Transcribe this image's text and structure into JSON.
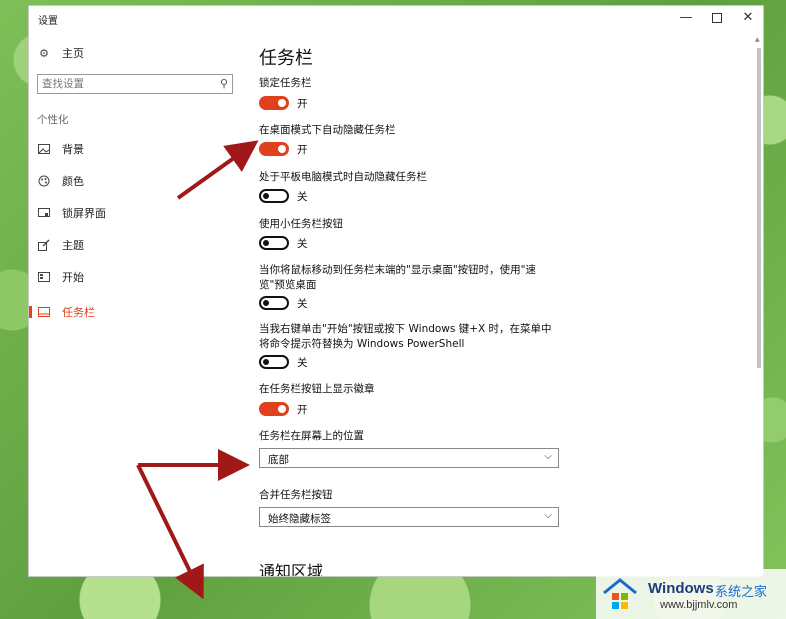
{
  "window": {
    "title": "设置",
    "min": "—",
    "close": "✕"
  },
  "sidebar": {
    "home": "主页",
    "search_placeholder": "查找设置",
    "group": "个性化",
    "items": [
      {
        "label": "背景",
        "icon": "image-icon"
      },
      {
        "label": "颜色",
        "icon": "palette-icon"
      },
      {
        "label": "锁屏界面",
        "icon": "lock-screen-icon"
      },
      {
        "label": "主题",
        "icon": "theme-icon"
      },
      {
        "label": "开始",
        "icon": "start-icon"
      },
      {
        "label": "任务栏",
        "icon": "taskbar-icon",
        "active": true
      }
    ],
    "accent": "#e0401b"
  },
  "content": {
    "title": "任务栏",
    "settings": [
      {
        "label": "锁定任务栏",
        "on": true,
        "state": "开"
      },
      {
        "label": "在桌面模式下自动隐藏任务栏",
        "on": true,
        "state": "开"
      },
      {
        "label": "处于平板电脑模式时自动隐藏任务栏",
        "on": false,
        "state": "关"
      },
      {
        "label": "使用小任务栏按钮",
        "on": false,
        "state": "关"
      },
      {
        "label": "当你将鼠标移动到任务栏末端的\"显示桌面\"按钮时，使用\"速览\"预览桌面",
        "on": false,
        "state": "关"
      },
      {
        "label": "当我右键单击\"开始\"按钮或按下 Windows 键+X 时，在菜单中将命令提示符替换为 Windows PowerShell",
        "on": false,
        "state": "关"
      },
      {
        "label": "在任务栏按钮上显示徽章",
        "on": true,
        "state": "开"
      }
    ],
    "position_label": "任务栏在屏幕上的位置",
    "position_value": "底部",
    "combine_label": "合并任务栏按钮",
    "combine_value": "始终隐藏标签",
    "section2": "通知区域"
  },
  "watermark": {
    "title": "Windows",
    "subtitle": "系统之家",
    "url": "www.bjjmlv.com"
  }
}
